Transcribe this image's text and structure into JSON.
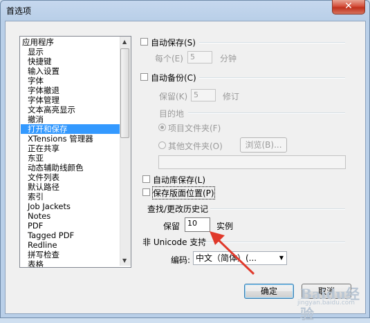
{
  "window": {
    "title": "首选项",
    "close": "✕"
  },
  "categories": [
    "应用程序",
    "显示",
    "快捷键",
    "输入设置",
    "字体",
    "字体撤退",
    "字体管理",
    "文本高亮显示",
    "撤消",
    "打开和保存",
    "XTensions 管理器",
    "正在共享",
    "东亚",
    "动态辅助线颜色",
    "文件列表",
    "默认路径",
    "索引",
    "Job Jackets",
    "Notes",
    "PDF",
    "Tagged PDF",
    "Redline",
    "拼写检查",
    "表格"
  ],
  "selected_category": "打开和保存",
  "autosave": {
    "label": "自动保存(S)",
    "every_label": "每个(E)",
    "value": "5",
    "unit": "分钟",
    "checked": false
  },
  "autobackup": {
    "label": "自动备份(C)",
    "keep_label": "保留(K)",
    "value": "5",
    "unit": "修订",
    "checked": false
  },
  "destination": {
    "heading": "目的地",
    "project_folder": "项目文件夹(F)",
    "other_folder": "其他文件夹(O)",
    "browse": "浏览(B)...",
    "selected": "project_folder"
  },
  "autolibrary": {
    "label": "自动库保存(L)",
    "checked": false
  },
  "save_layout": {
    "label": "保存版面位置(P)",
    "checked": false
  },
  "history": {
    "heading": "查找/更改历史记",
    "keep_label": "保留",
    "value": "10",
    "unit": "实例"
  },
  "non_unicode": {
    "heading": "非 Unicode 支持",
    "encoding_label": "编码:",
    "encoding_value": "中文（简体）(..."
  },
  "buttons": {
    "ok": "确定",
    "cancel": "取消"
  },
  "watermark": {
    "text": "Baidu经验",
    "url": "jingyan.baidu.com"
  }
}
